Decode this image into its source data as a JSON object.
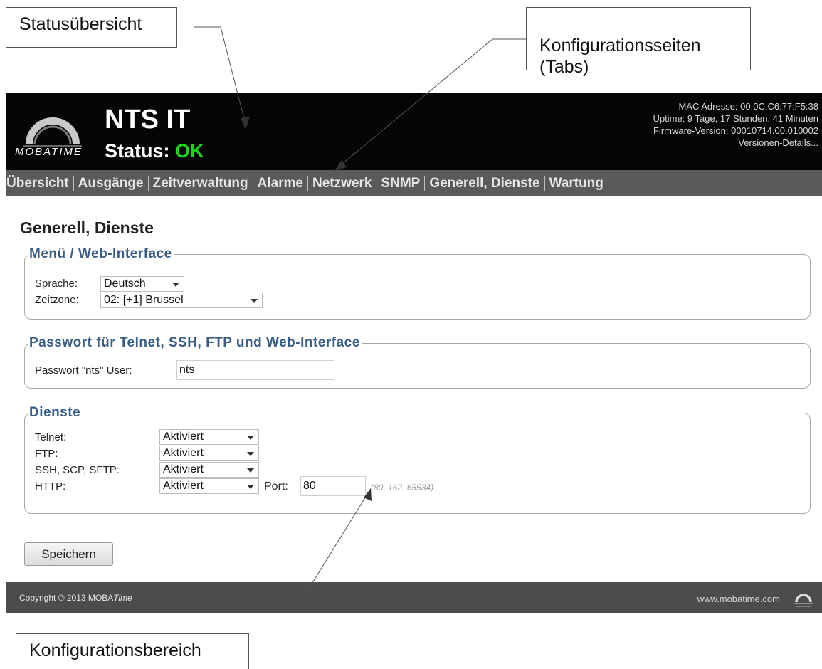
{
  "annotations": {
    "status_overview": "Statusübersicht",
    "config_pages": "Konfigurationsseiten\n(Tabs)",
    "config_area": "Konfigurationsbereich"
  },
  "header": {
    "logo_text": "MOBATIME",
    "product": "NTS IT",
    "status_label": "Status:",
    "status_value": "OK",
    "mac": "MAC Adresse: 00:0C:C6:77:F5:38",
    "uptime": "Uptime: 9 Tage, 17 Stunden, 41 Minuten",
    "firmware": "Firmware-Version: 00010714.00.010002",
    "version_details": "Versionen-Details..."
  },
  "nav": {
    "items": [
      "Übersicht",
      "Ausgänge",
      "Zeitverwaltung",
      "Alarme",
      "Netzwerk",
      "SNMP",
      "Generell, Dienste",
      "Wartung"
    ]
  },
  "page_title": "Generell, Dienste",
  "menu_group": {
    "legend": "Menü / Web-Interface",
    "language_label": "Sprache:",
    "language_value": "Deutsch",
    "timezone_label": "Zeitzone:",
    "timezone_value": "02: [+1] Brussel"
  },
  "password_group": {
    "legend": "Passwort für Telnet, SSH, FTP und Web-Interface",
    "user_label": "Passwort \"nts\" User:",
    "user_value": "nts"
  },
  "services_group": {
    "legend": "Dienste",
    "rows": [
      {
        "label": "Telnet:",
        "value": "Aktiviert"
      },
      {
        "label": "FTP:",
        "value": "Aktiviert"
      },
      {
        "label": "SSH, SCP, SFTP:",
        "value": "Aktiviert"
      },
      {
        "label": "HTTP:",
        "value": "Aktiviert"
      }
    ],
    "port_label": "Port:",
    "port_value": "80",
    "port_hint": "(80, 162..65534)"
  },
  "save_label": "Speichern",
  "footer": {
    "copyright_prefix": "Copyright © 2013 MOBA",
    "copyright_italic": "Time",
    "url": "www.mobatime.com"
  },
  "colors": {
    "header_bg": "#050505",
    "nav_bg": "#5a5a5a",
    "status_ok": "#19d619",
    "legend": "#3a5d86",
    "footer_bg": "#4c4c4c"
  }
}
